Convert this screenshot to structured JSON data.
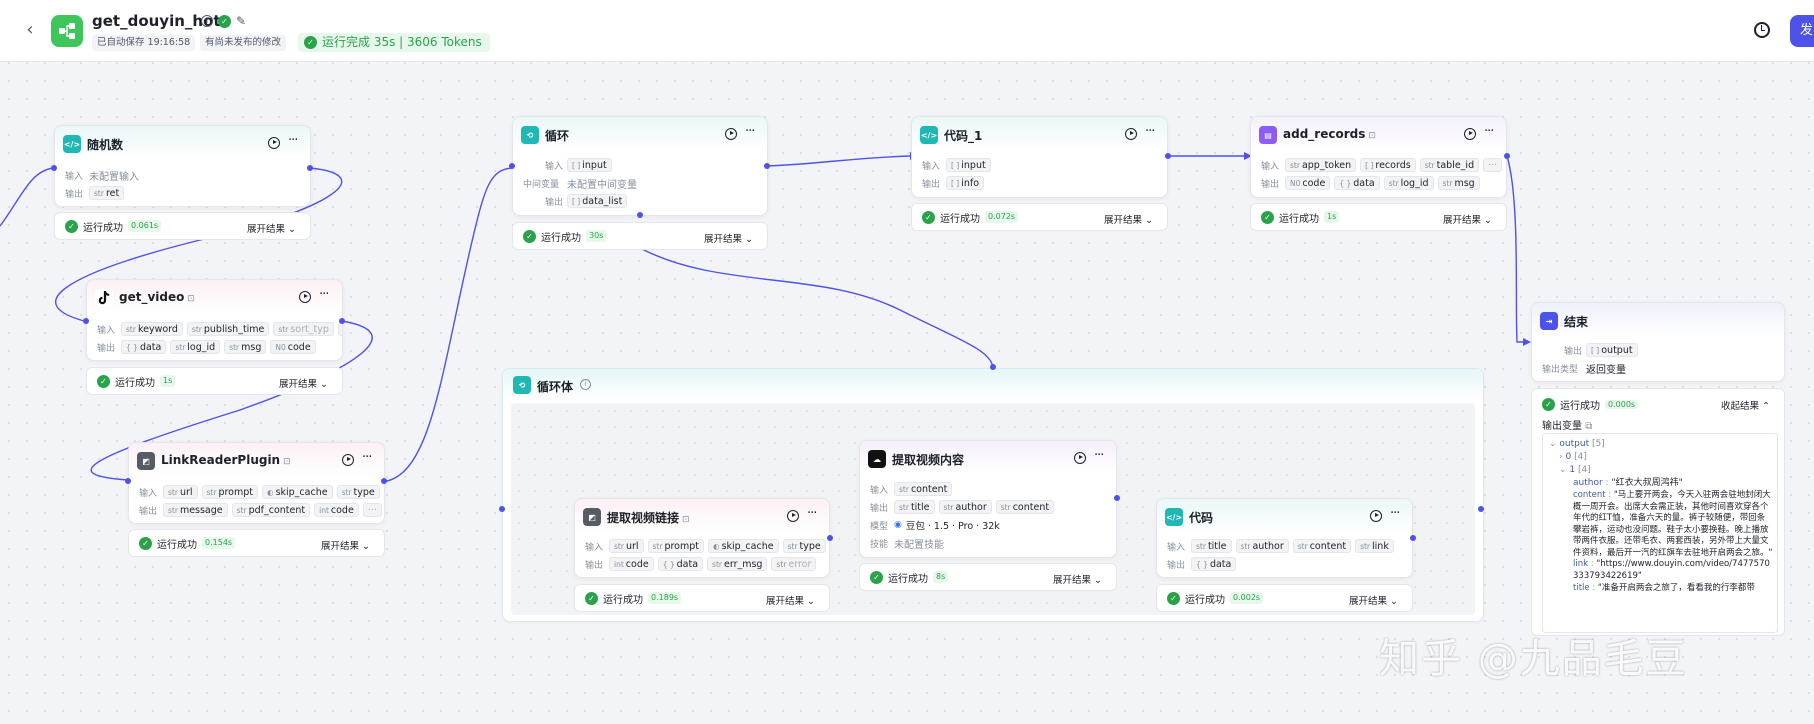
{
  "header": {
    "back_icon": "chevron-left-icon",
    "app_icon": "workflow-icon",
    "title": "get_douyin_hot",
    "autosave": "已自动保存 19:16:58",
    "unpublished": "有尚未发布的修改",
    "run_status": "运行完成 35s | 3606 Tokens",
    "publish_label": "发"
  },
  "common": {
    "input_label": "输入",
    "output_label": "输出",
    "run_success": "运行成功",
    "expand": "展开结果",
    "collapse": "收起结果"
  },
  "nodes": {
    "random": {
      "title": "随机数",
      "input_placeholder": "未配置输入",
      "output": "ret",
      "time": "0.061s"
    },
    "get_video": {
      "title": "get_video",
      "inputs": [
        "keyword",
        "publish_time",
        "sort_typ"
      ],
      "outputs": [
        "data",
        "log_id",
        "msg",
        "code"
      ],
      "time": "1s"
    },
    "link_reader": {
      "title": "LinkReaderPlugin",
      "inputs": [
        "url",
        "prompt",
        "skip_cache",
        "type"
      ],
      "outputs": [
        "message",
        "pdf_content",
        "code"
      ],
      "time": "0.154s"
    },
    "loop": {
      "title": "循环",
      "input": "input",
      "mid_label": "中间变量",
      "mid_value": "未配置中间变量",
      "output": "data_list",
      "time": "30s"
    },
    "code_1": {
      "title": "代码_1",
      "input": "input",
      "output": "info",
      "time": "0.072s"
    },
    "add_records": {
      "title": "add_records",
      "inputs": [
        "app_token",
        "records",
        "table_id"
      ],
      "outputs": [
        "code",
        "data",
        "log_id",
        "msg"
      ],
      "time": "1s"
    },
    "end": {
      "title": "结束",
      "output": "output",
      "type_label": "输出类型",
      "type_value": "返回变量",
      "time": "0.000s"
    },
    "extract_link": {
      "title": "提取视频链接",
      "inputs": [
        "url",
        "prompt",
        "skip_cache",
        "type"
      ],
      "outputs": [
        "code",
        "data",
        "err_msg",
        "error"
      ],
      "time": "0.189s"
    },
    "extract_content": {
      "title": "提取视频内容",
      "input": "content",
      "outputs": [
        "title",
        "author",
        "content"
      ],
      "model_label": "模型",
      "model_value": "豆包 · 1.5 · Pro · 32k",
      "skill_label": "技能",
      "skill_value": "未配置技能",
      "time": "8s"
    },
    "code": {
      "title": "代码",
      "inputs": [
        "title",
        "author",
        "content",
        "link"
      ],
      "output": "data",
      "time": "0.002s"
    }
  },
  "loop_body": {
    "title": "循环体"
  },
  "end_result": {
    "output_var_label": "输出变量",
    "root": "output",
    "root_count": "[5]",
    "item0": "0",
    "item0_count": "[4]",
    "item1": "1",
    "item1_count": "[4]",
    "author_key": "author",
    "author_val": "\"红衣大叔周鸿祎\"",
    "content_key": "content",
    "content_val": "\"马上要开两会，今天入驻两会驻地封闭大概一周开会。出席大会需正装，其他时间喜欢穿各个年代的红T恤，准备六天的量。裤子较随便，带回条攀岩裤，运动也没问题。鞋子太小要换鞋。晚上播放带两件衣服。还带毛衣、两套西装，另外带上大量文件资料，最后开一汽的红旗车去驻地开启两会之旅。\"",
    "link_key": "link",
    "link_val": "\"https://www.douyin.com/video/7477570333793422619\"",
    "title_key": "title",
    "title_val": "\"准备开启两会之旅了，看看我的行李都带"
  },
  "watermark": "知乎 @九品毛豆",
  "colors": {
    "accent": "#4d53e8",
    "success": "#2aa24a",
    "teal": "#1fb8b5"
  }
}
